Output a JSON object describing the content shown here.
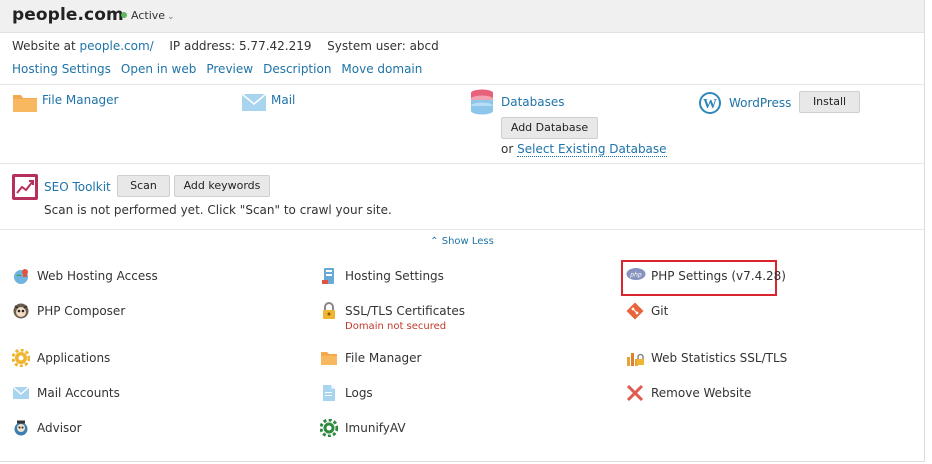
{
  "header": {
    "domain": "people.com",
    "status": "Active"
  },
  "info": {
    "website_label": "Website at",
    "website_value": "people.com/",
    "ip_label": "IP address:",
    "ip_value": "5.77.42.219",
    "user_label": "System user:",
    "user_value": "abcd"
  },
  "links": [
    "Hosting Settings",
    "Open in web",
    "Preview",
    "Description",
    "Move domain"
  ],
  "tools": {
    "file_manager": "File Manager",
    "mail": "Mail",
    "databases": "Databases",
    "add_database": "Add Database",
    "or": "or",
    "select_existing_db": "Select Existing Database",
    "wordpress": "WordPress",
    "install": "Install",
    "seo_toolkit": "SEO Toolkit",
    "scan": "Scan",
    "add_keywords": "Add keywords",
    "seo_note": "Scan is not performed yet. Click \"Scan\" to crawl your site."
  },
  "show_less": "Show Less",
  "grid": {
    "web_hosting_access": "Web Hosting Access",
    "hosting_settings": "Hosting Settings",
    "php_settings": "PHP Settings (v7.4.28)",
    "php_composer": "PHP Composer",
    "ssl_tls": "SSL/TLS Certificates",
    "ssl_status": "Domain not secured",
    "git": "Git",
    "applications": "Applications",
    "file_manager": "File Manager",
    "web_statistics": "Web Statistics SSL/TLS",
    "mail_accounts": "Mail Accounts",
    "logs": "Logs",
    "remove_website": "Remove Website",
    "advisor": "Advisor",
    "imunifyav": "ImunifyAV"
  },
  "colors": {
    "link": "#1e73a8",
    "active_dot": "#5cb85c",
    "highlight": "#d9252f",
    "error": "#c0392b"
  }
}
